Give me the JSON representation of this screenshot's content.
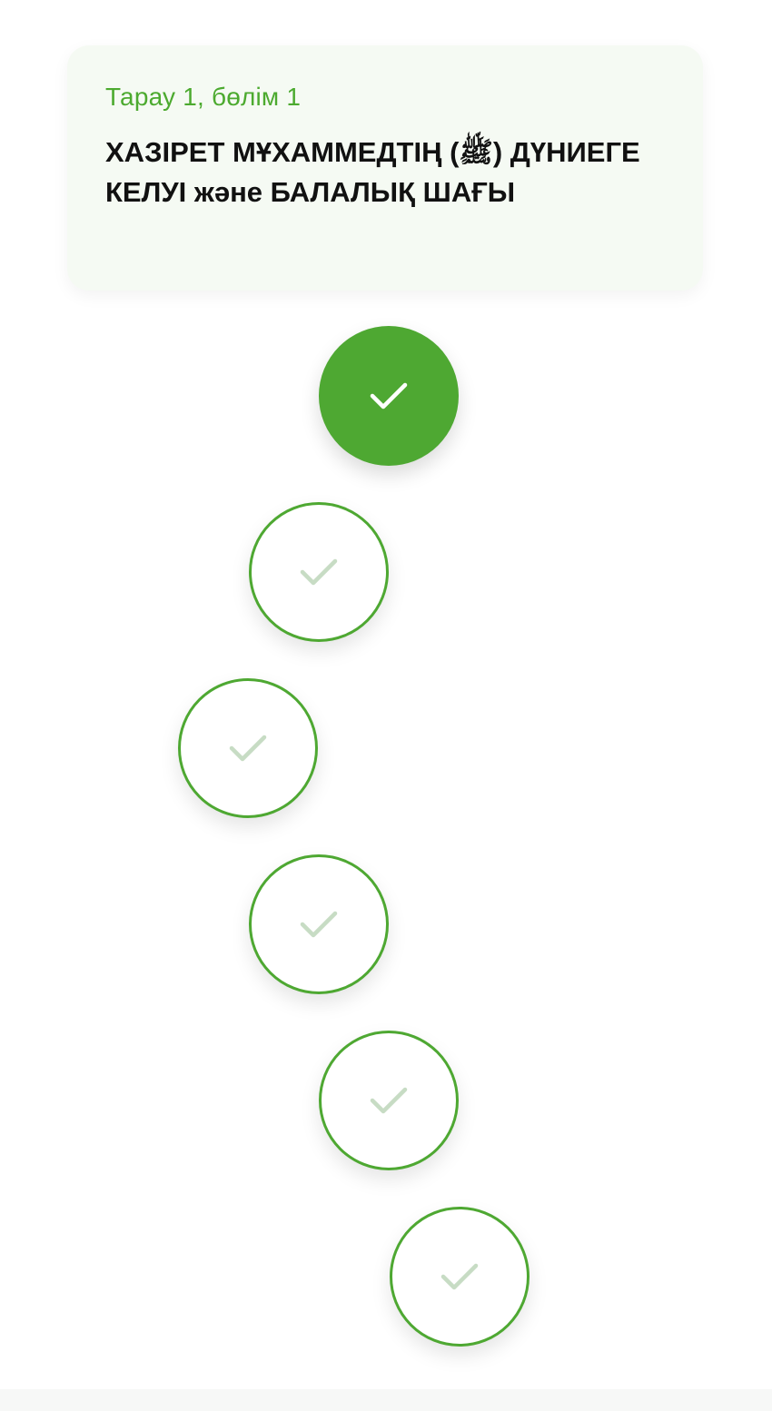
{
  "header": {
    "chapter_label": "Тарау 1, бөлім 1",
    "title": "ХАЗІРЕТ МҰХАММЕДТІҢ (ﷺ) ДҮНИЕГЕ КЕЛУІ және БАЛАЛЫҚ ШАҒЫ"
  },
  "path": {
    "nodes": [
      {
        "state": "completed",
        "icon": "check-icon"
      },
      {
        "state": "locked",
        "icon": "check-icon"
      },
      {
        "state": "locked",
        "icon": "check-icon"
      },
      {
        "state": "locked",
        "icon": "check-icon"
      },
      {
        "state": "locked",
        "icon": "check-icon"
      },
      {
        "state": "locked",
        "icon": "check-icon"
      }
    ]
  },
  "colors": {
    "accent": "#4ea832",
    "card_background": "#f5faf3",
    "pending_check": "#c7dcc4",
    "completed_check": "#ffffff"
  }
}
